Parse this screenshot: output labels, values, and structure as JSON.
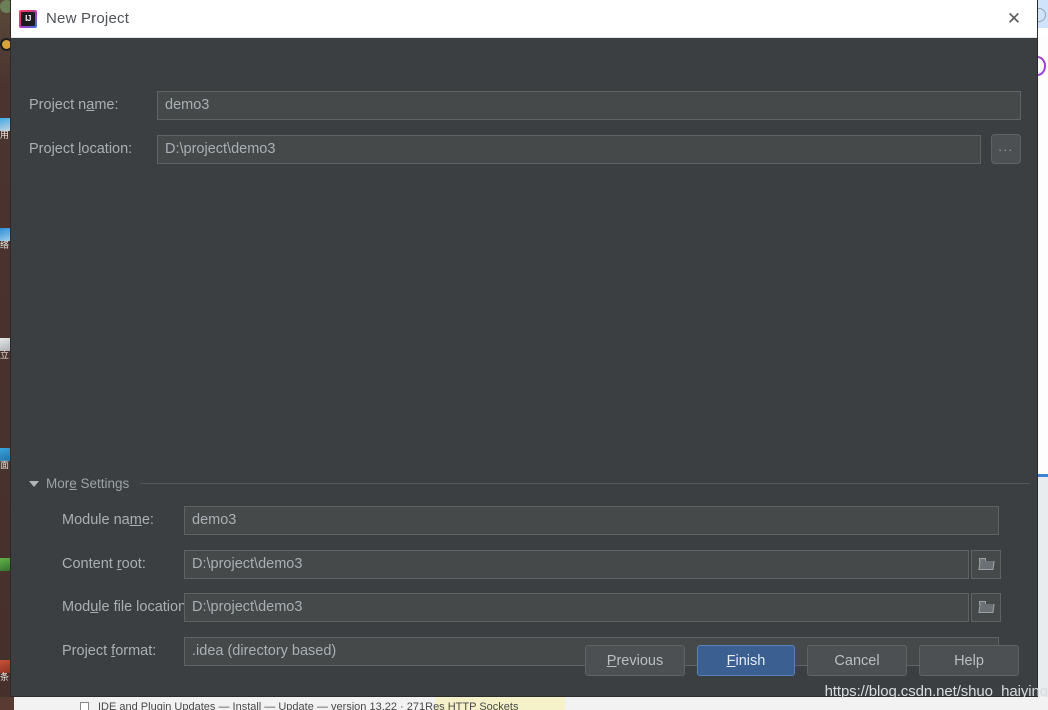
{
  "window": {
    "title": "New Project",
    "app_icon": "intellij-idea-icon",
    "icon_text": "IJ",
    "close_icon": "close-icon"
  },
  "form": {
    "project_name": {
      "label_before": "Project n",
      "label_mnemonic": "a",
      "label_after": "me:",
      "value": "demo3"
    },
    "project_location": {
      "label_before": "Project ",
      "label_mnemonic": "l",
      "label_after": "ocation:",
      "value": "D:\\project\\demo3",
      "browse_label": "...",
      "browse_icon": "ellipsis-icon"
    }
  },
  "more_settings": {
    "label_before": "Mor",
    "label_mnemonic": "e",
    "label_after": " Settings",
    "expanded": true,
    "collapse_icon": "chevron-down-icon",
    "module_name": {
      "label_before": "Module na",
      "label_mnemonic": "m",
      "label_after": "e:",
      "value": "demo3"
    },
    "content_root": {
      "label_before": "Content ",
      "label_mnemonic": "r",
      "label_after": "oot:",
      "value": "D:\\project\\demo3",
      "browse_icon": "folder-icon"
    },
    "module_file_location": {
      "label_before": "Mod",
      "label_mnemonic": "u",
      "label_after": "le file location:",
      "value": "D:\\project\\demo3",
      "browse_icon": "folder-icon"
    },
    "project_format": {
      "label_before": "Project ",
      "label_mnemonic": "f",
      "label_after": "ormat:",
      "value": ".idea (directory based)",
      "dropdown_icon": "chevron-down-icon",
      "options": [
        ".idea (directory based)"
      ]
    }
  },
  "buttons": {
    "previous": {
      "before": "",
      "mnemonic": "P",
      "after": "revious"
    },
    "finish": {
      "before": "",
      "mnemonic": "F",
      "after": "inish"
    },
    "cancel": {
      "before": "Cancel",
      "mnemonic": "",
      "after": ""
    },
    "help": {
      "before": "Help",
      "mnemonic": "",
      "after": ""
    }
  },
  "watermark": "https://blog.csdn.net/shuo_haiying",
  "bottom_strip": {
    "text": "IDE and Plugin Updates  —  Install  —  Update  —  version  13.22 · 271Res  HTTP Sockets"
  },
  "colors": {
    "dialog_bg": "#3c3f41",
    "field_bg": "#45494a",
    "field_border": "#5e6364",
    "text": "#a9b0b4",
    "titlebar_bg": "#ffffff",
    "accent_primary": "#3c5f91",
    "accent_primary_border": "#5782bb",
    "button_bg": "#4c5052",
    "desktop_bg": "#4a3430"
  }
}
